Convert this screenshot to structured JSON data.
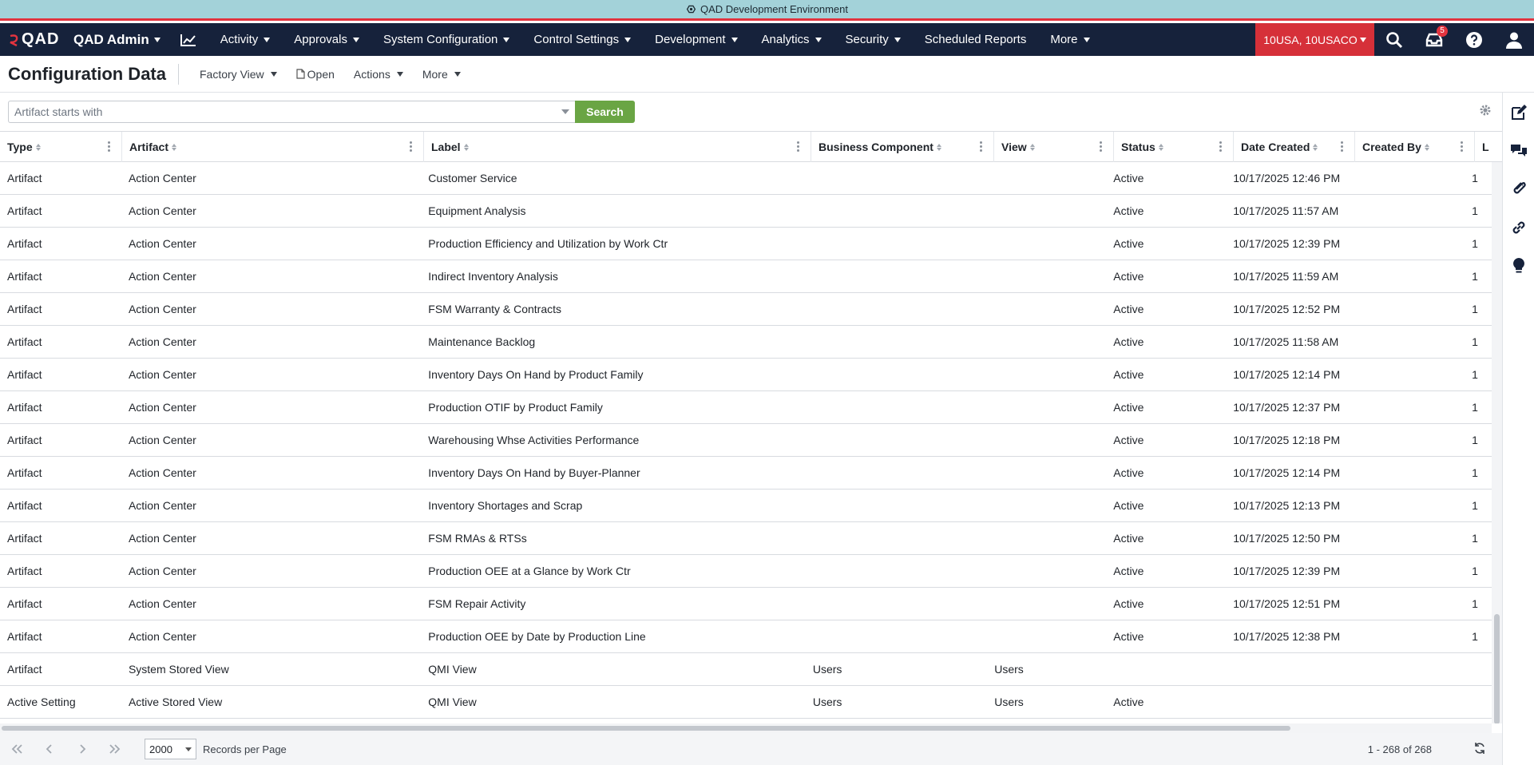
{
  "env": {
    "title": "QAD Development Environment"
  },
  "nav": {
    "logo": "QAD",
    "app_name": "QAD Admin",
    "items": [
      "Activity",
      "Approvals",
      "System Configuration",
      "Control Settings",
      "Development",
      "Analytics",
      "Security",
      "Scheduled Reports",
      "More"
    ],
    "domain": "10USA, 10USACO",
    "inbox_badge": "5"
  },
  "page": {
    "title": "Configuration Data",
    "view_label": "Factory View",
    "open_label": "Open",
    "actions_label": "Actions",
    "more_label": "More"
  },
  "search": {
    "placeholder": "Artifact starts with",
    "button_label": "Search"
  },
  "grid": {
    "columns": [
      "Type",
      "Artifact",
      "Label",
      "Business Component",
      "View",
      "Status",
      "Date Created",
      "Created By",
      "L"
    ],
    "rows": [
      [
        "Artifact",
        "Action Center",
        "Customer Service",
        "",
        "",
        "Active",
        "10/17/2025 12:46 PM",
        "",
        "1"
      ],
      [
        "Artifact",
        "Action Center",
        "Equipment Analysis",
        "",
        "",
        "Active",
        "10/17/2025 11:57 AM",
        "",
        "1"
      ],
      [
        "Artifact",
        "Action Center",
        "Production Efficiency and Utilization by Work Ctr",
        "",
        "",
        "Active",
        "10/17/2025 12:39 PM",
        "",
        "1"
      ],
      [
        "Artifact",
        "Action Center",
        "Indirect Inventory Analysis",
        "",
        "",
        "Active",
        "10/17/2025 11:59 AM",
        "",
        "1"
      ],
      [
        "Artifact",
        "Action Center",
        "FSM Warranty & Contracts",
        "",
        "",
        "Active",
        "10/17/2025 12:52 PM",
        "",
        "1"
      ],
      [
        "Artifact",
        "Action Center",
        "Maintenance Backlog",
        "",
        "",
        "Active",
        "10/17/2025 11:58 AM",
        "",
        "1"
      ],
      [
        "Artifact",
        "Action Center",
        "Inventory Days On Hand by Product Family",
        "",
        "",
        "Active",
        "10/17/2025 12:14 PM",
        "",
        "1"
      ],
      [
        "Artifact",
        "Action Center",
        "Production OTIF by Product Family",
        "",
        "",
        "Active",
        "10/17/2025 12:37 PM",
        "",
        "1"
      ],
      [
        "Artifact",
        "Action Center",
        "Warehousing Whse Activities Performance",
        "",
        "",
        "Active",
        "10/17/2025 12:18 PM",
        "",
        "1"
      ],
      [
        "Artifact",
        "Action Center",
        "Inventory Days On Hand by Buyer-Planner",
        "",
        "",
        "Active",
        "10/17/2025 12:14 PM",
        "",
        "1"
      ],
      [
        "Artifact",
        "Action Center",
        "Inventory Shortages and Scrap",
        "",
        "",
        "Active",
        "10/17/2025 12:13 PM",
        "",
        "1"
      ],
      [
        "Artifact",
        "Action Center",
        "FSM RMAs & RTSs",
        "",
        "",
        "Active",
        "10/17/2025 12:50 PM",
        "",
        "1"
      ],
      [
        "Artifact",
        "Action Center",
        "Production OEE at a Glance by Work Ctr",
        "",
        "",
        "Active",
        "10/17/2025 12:39 PM",
        "",
        "1"
      ],
      [
        "Artifact",
        "Action Center",
        "FSM Repair Activity",
        "",
        "",
        "Active",
        "10/17/2025 12:51 PM",
        "",
        "1"
      ],
      [
        "Artifact",
        "Action Center",
        "Production OEE by Date by Production Line",
        "",
        "",
        "Active",
        "10/17/2025 12:38 PM",
        "",
        "1"
      ],
      [
        "Artifact",
        "System Stored View",
        "QMI View",
        "Users",
        "Users",
        "",
        "",
        "",
        ""
      ],
      [
        "Active Setting",
        "Active Stored View",
        "QMI View",
        "Users",
        "Users",
        "Active",
        "",
        "",
        ""
      ]
    ]
  },
  "footer": {
    "page_size": "2000",
    "records_per_page": "Records per Page",
    "range": "1 - 268 of 268"
  },
  "colors": {
    "env_bar": "#a3d2d9",
    "nav_bg": "#16223b",
    "domain_bg": "#d63039",
    "search_btn": "#6aa544"
  }
}
